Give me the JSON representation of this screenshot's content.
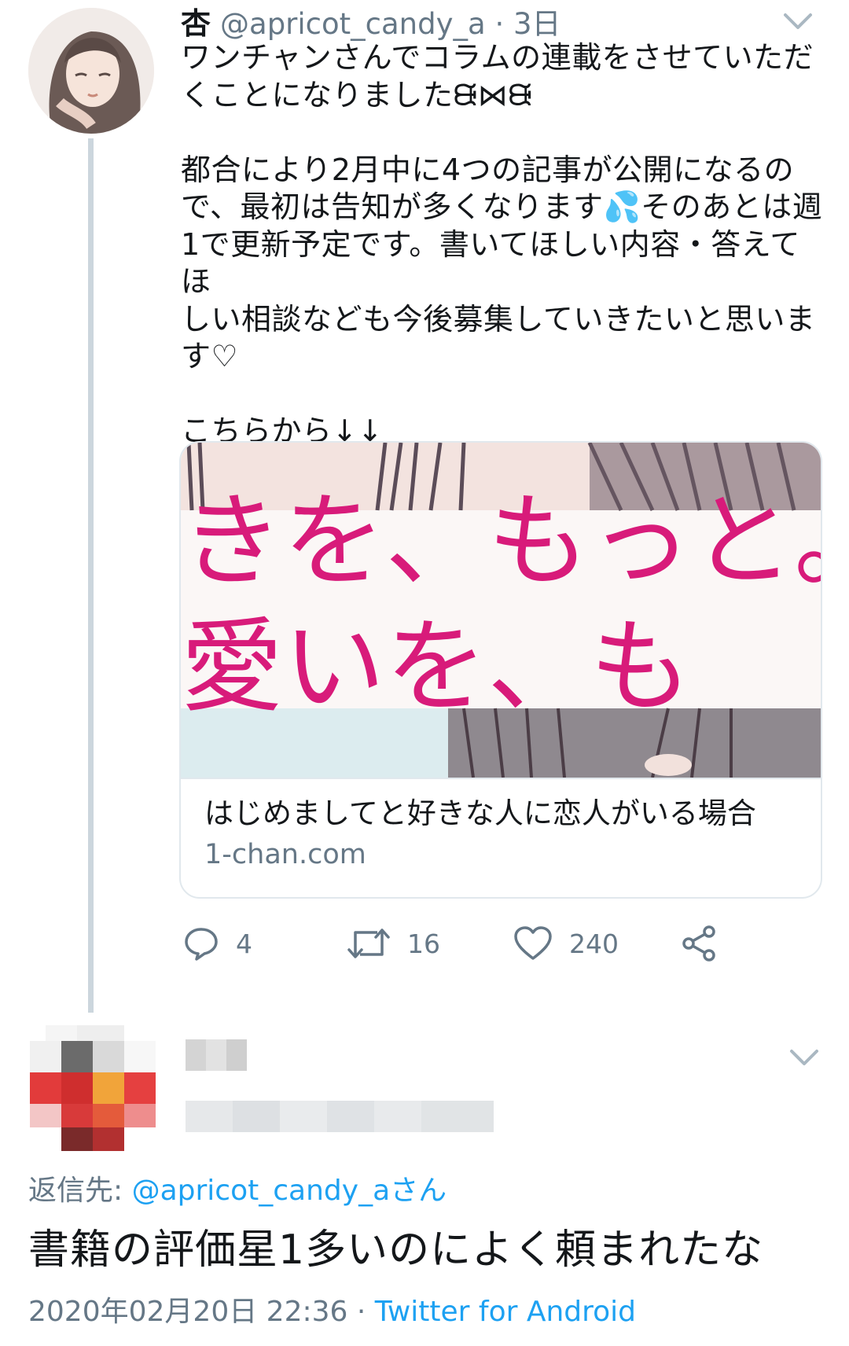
{
  "tweet": {
    "display_name": "杏",
    "handle": "@apricot_candy_a",
    "separator": "·",
    "time_ago": "3日",
    "text": "ワンチャンさんでコラムの連載をさせていただ\nくことになりましたᙠ⋈ᙠ\n\n都合により2月中に4つの記事が公開になるの\nで、最初は告知が多くなります💦そのあとは週\n1で更新予定です。書いてほしい内容・答えてほ\nしい相談なども今後募集していきたいと思いま\nす♡\n\nこちらから↓↓",
    "card": {
      "image_text_line1": "きを、もっと。",
      "image_text_line2": "愛いを、も",
      "title": "はじめましてと好きな人に恋人がいる場合",
      "domain": "1-chan.com"
    },
    "actions": {
      "reply_count": "4",
      "retweet_count": "16",
      "like_count": "240"
    }
  },
  "reply": {
    "reply_to_prefix": "返信先:",
    "reply_to_handle": "@apricot_candy_aさん",
    "text": "書籍の評価星1多いのによく頼まれたな",
    "timestamp": "2020年02月20日 22:36",
    "separator": "·",
    "source": "Twitter for Android"
  },
  "colors": {
    "text": "#14171a",
    "secondary": "#657786",
    "link": "#1da1f2",
    "border": "#e1e8ed",
    "card_pink": "#d81b7a"
  }
}
